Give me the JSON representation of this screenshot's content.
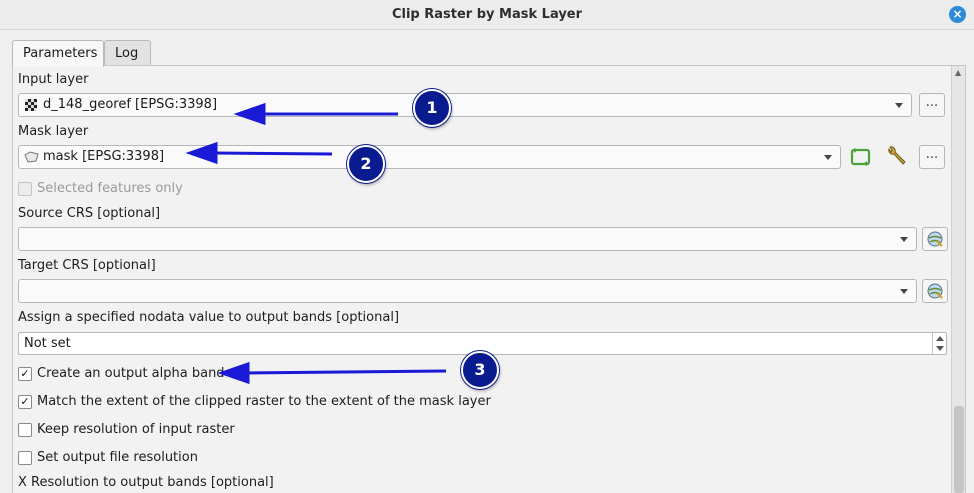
{
  "window": {
    "title": "Clip Raster by Mask Layer",
    "close_glyph": "×"
  },
  "tabs": [
    {
      "label": "Parameters"
    },
    {
      "label": "Log"
    }
  ],
  "fields": {
    "input_layer": {
      "label": "Input layer",
      "value": "d_148_georef [EPSG:3398]",
      "icon": "raster-layer-icon",
      "more": "..."
    },
    "mask_layer": {
      "label": "Mask layer",
      "value": "mask [EPSG:3398]",
      "icon": "polygon-layer-icon",
      "more": "..."
    },
    "selected_only": {
      "label": "Selected features only",
      "checked": false,
      "enabled": false
    },
    "source_crs": {
      "label": "Source CRS [optional]",
      "value": ""
    },
    "target_crs": {
      "label": "Target CRS [optional]",
      "value": ""
    },
    "nodata": {
      "label": "Assign a specified nodata value to output bands [optional]",
      "value": "Not set"
    },
    "alpha_band": {
      "label": "Create an output alpha band",
      "checked": true
    },
    "match_extent": {
      "label": "Match the extent of the clipped raster to the extent of the mask layer",
      "checked": true
    },
    "keep_resolution": {
      "label": "Keep resolution of input raster",
      "checked": false
    },
    "set_resolution": {
      "label": "Set output file resolution",
      "checked": false
    },
    "x_resolution": {
      "label": "X Resolution to output bands [optional]"
    }
  },
  "check_glyph": "✓",
  "annotations": [
    {
      "number": "1"
    },
    {
      "number": "2"
    },
    {
      "number": "3"
    }
  ],
  "colors": {
    "annotation": "#0a1a8f",
    "arrow": "#1a1ad6",
    "accent": "#2d8bd8"
  }
}
